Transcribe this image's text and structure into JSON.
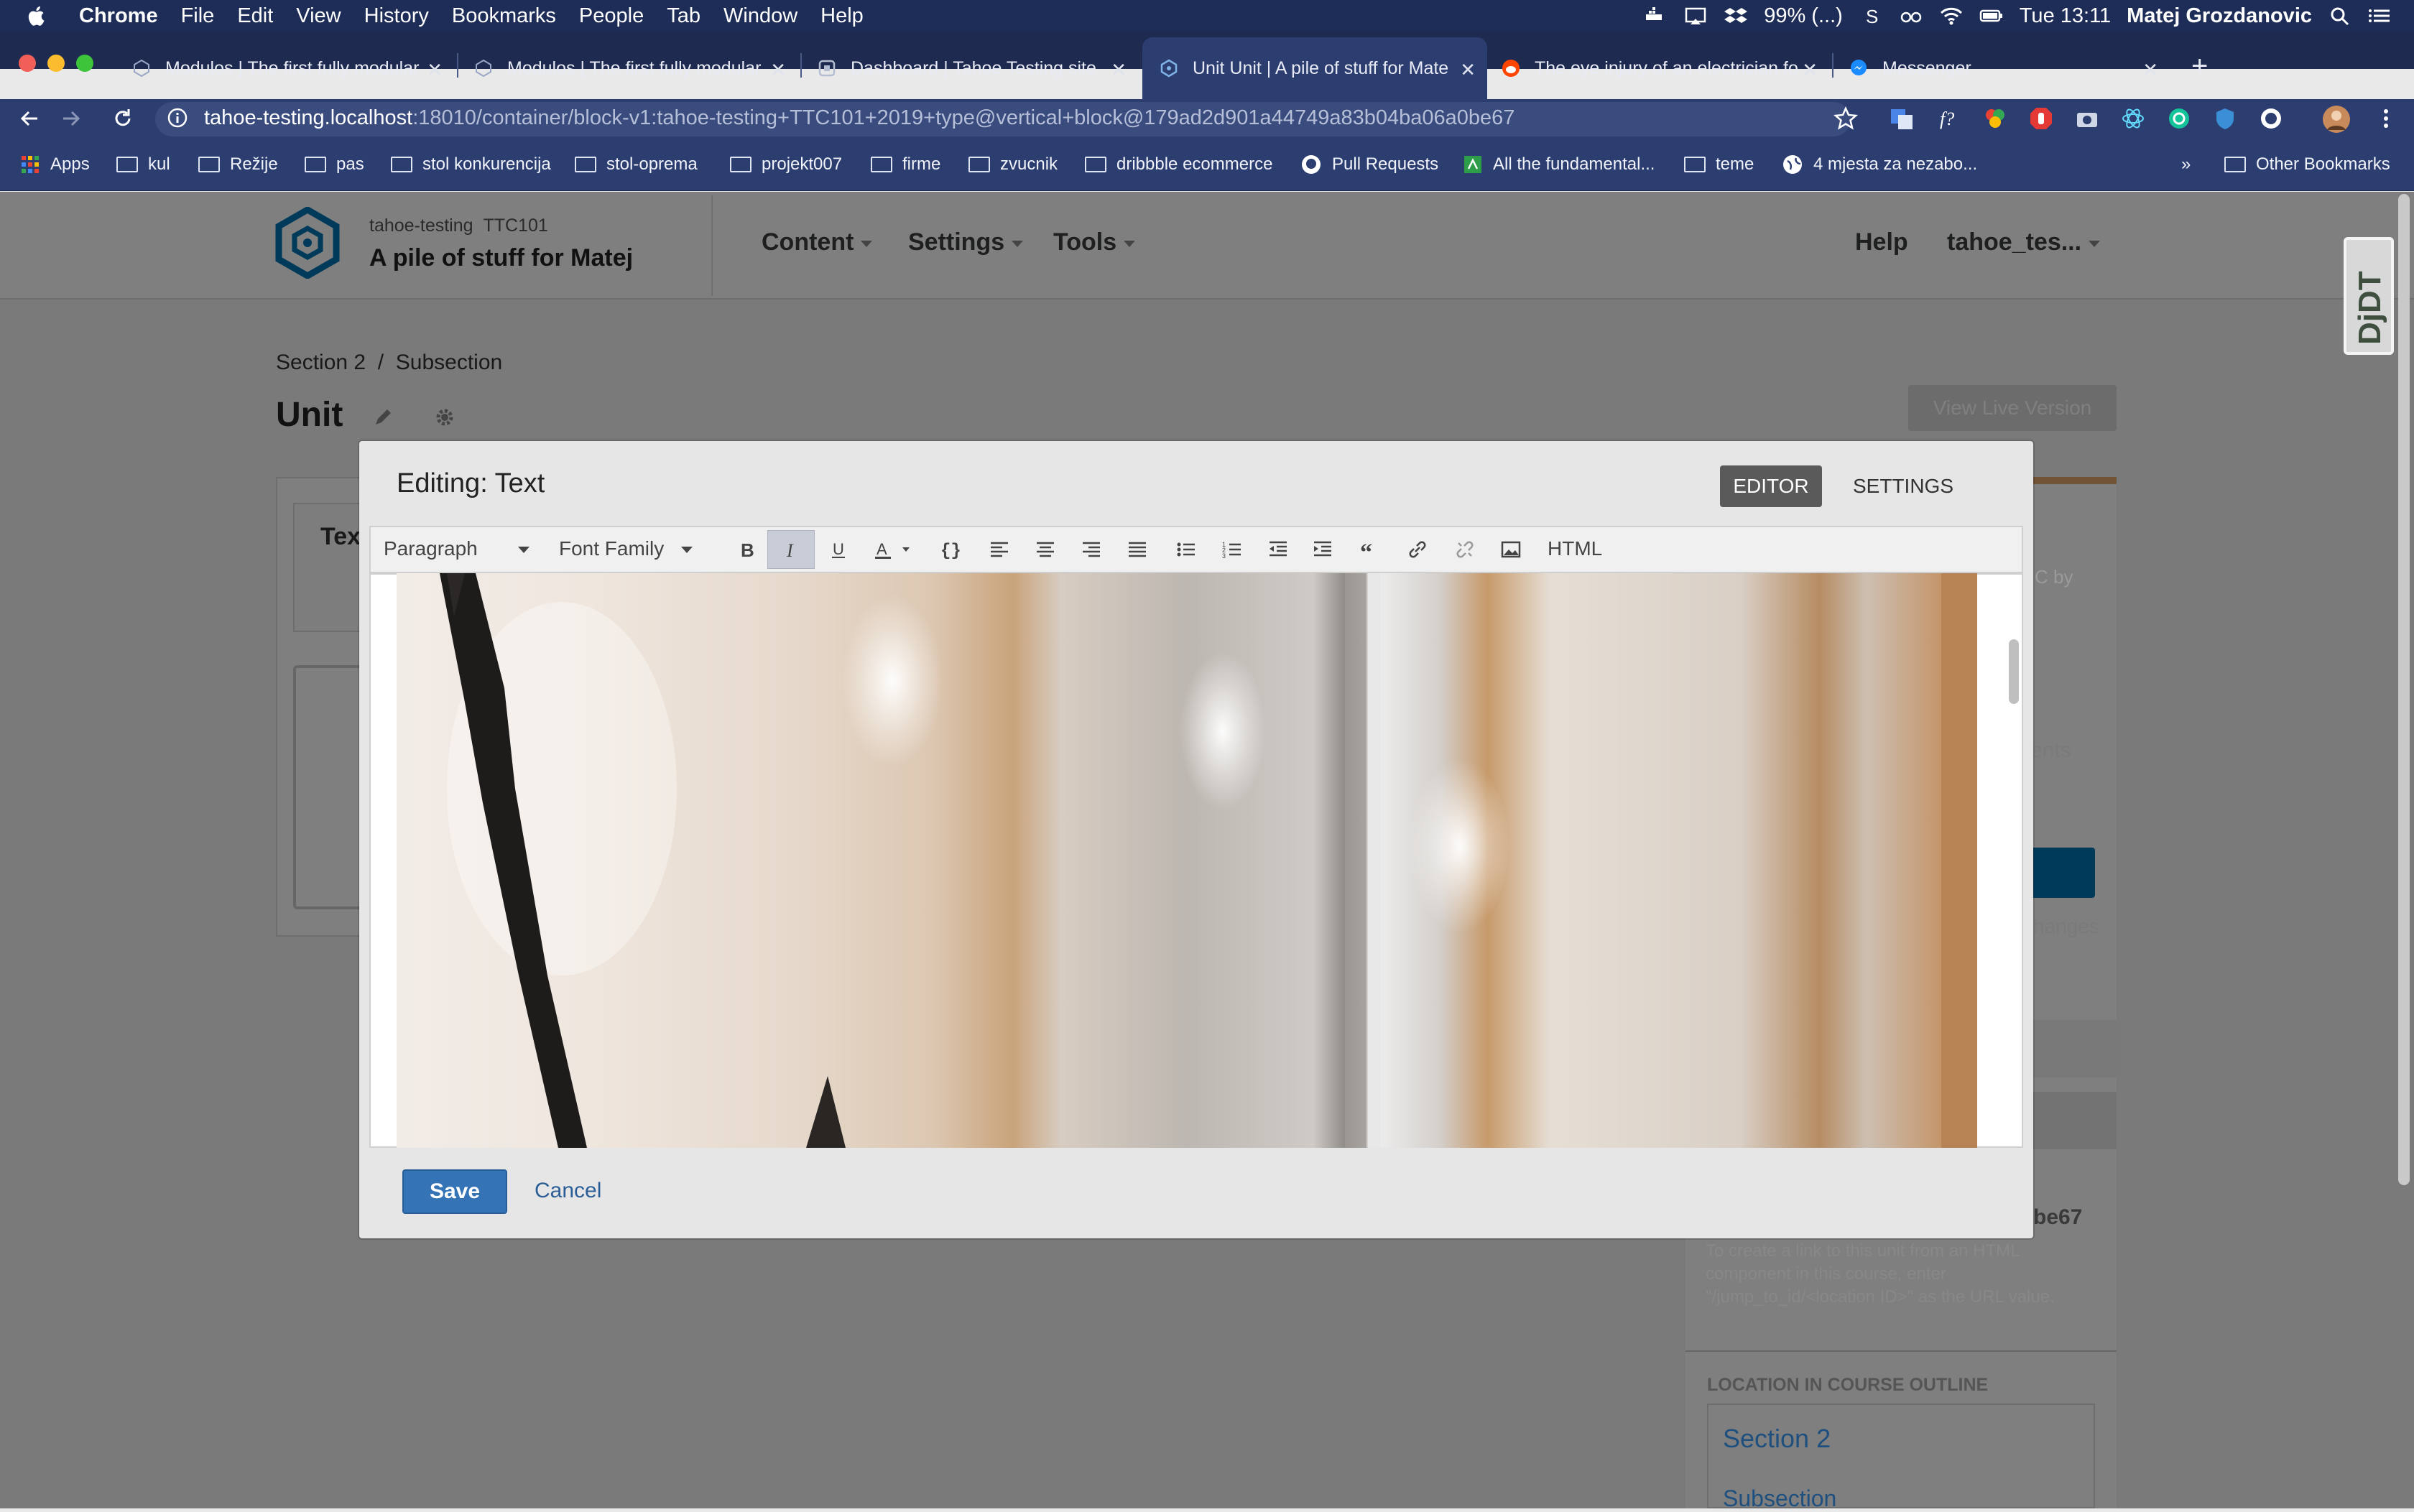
{
  "menubar": {
    "app": "Chrome",
    "items": [
      "File",
      "Edit",
      "View",
      "History",
      "Bookmarks",
      "People",
      "Tab",
      "Window",
      "Help"
    ],
    "battery": "99% (...)",
    "time": "Tue 13:11",
    "user": "Matej Grozdanovic"
  },
  "tabs": [
    {
      "title": "Modulos | The first fully modular"
    },
    {
      "title": "Modulos | The first fully modular"
    },
    {
      "title": "Dashboard | Tahoe Testing site"
    },
    {
      "title": "Unit Unit | A pile of stuff for Mate"
    },
    {
      "title": "The eye injury of an electrician fo"
    },
    {
      "title": "Messenger"
    }
  ],
  "address": {
    "host": "tahoe-testing.localhost",
    "rest": ":18010/container/block-v1:tahoe-testing+TTC101+2019+type@vertical+block@179ad2d901a44749a83b04ba06a0be67"
  },
  "bookmarks": [
    "Apps",
    "kul",
    "Režije",
    "pas",
    "stol konkurencija",
    "stol-oprema",
    "projekt007",
    "firme",
    "zvucnik",
    "dribbble ecommerce",
    "Pull Requests",
    "All the fundamental...",
    "teme",
    "4 mjesta za nezabo...",
    "»",
    "Other Bookmarks"
  ],
  "studio": {
    "org": "tahoe-testing",
    "course_code": "TTC101",
    "course_title": "A pile of stuff for Matej",
    "nav": [
      "Content",
      "Settings",
      "Tools"
    ],
    "help": "Help",
    "user": "tahoe_tes...",
    "breadcrumb": [
      "Section 2",
      "Subsection"
    ],
    "unit_title": "Unit",
    "view_live": "View Live Version",
    "side_fragments": {
      "c_by": "C by",
      "ents": "ents",
      "hanges": "hanges",
      "id_tail": "be67",
      "hint": "To create a link to this unit from an HTML component in this course, enter \"/jump_to_id/<location ID>\" as the URL value.",
      "location_heading": "LOCATION IN COURSE OUTLINE",
      "loc_section": "Section 2",
      "loc_subsection": "Subsection"
    },
    "tex_fragment": "Tex"
  },
  "modal": {
    "title": "Editing: Text",
    "tab_editor": "EDITOR",
    "tab_settings": "SETTINGS",
    "toolbar": {
      "format_select": "Paragraph",
      "font_select": "Font Family",
      "html_button": "HTML"
    },
    "save_label": "Save",
    "cancel_label": "Cancel"
  },
  "colors": {
    "menubar": "#1d2d57",
    "chrome_toolbar": "#2c3d70",
    "save_button": "#3473b5",
    "studio_brand": "#0075b4"
  },
  "devtools_badge": "DjDT"
}
